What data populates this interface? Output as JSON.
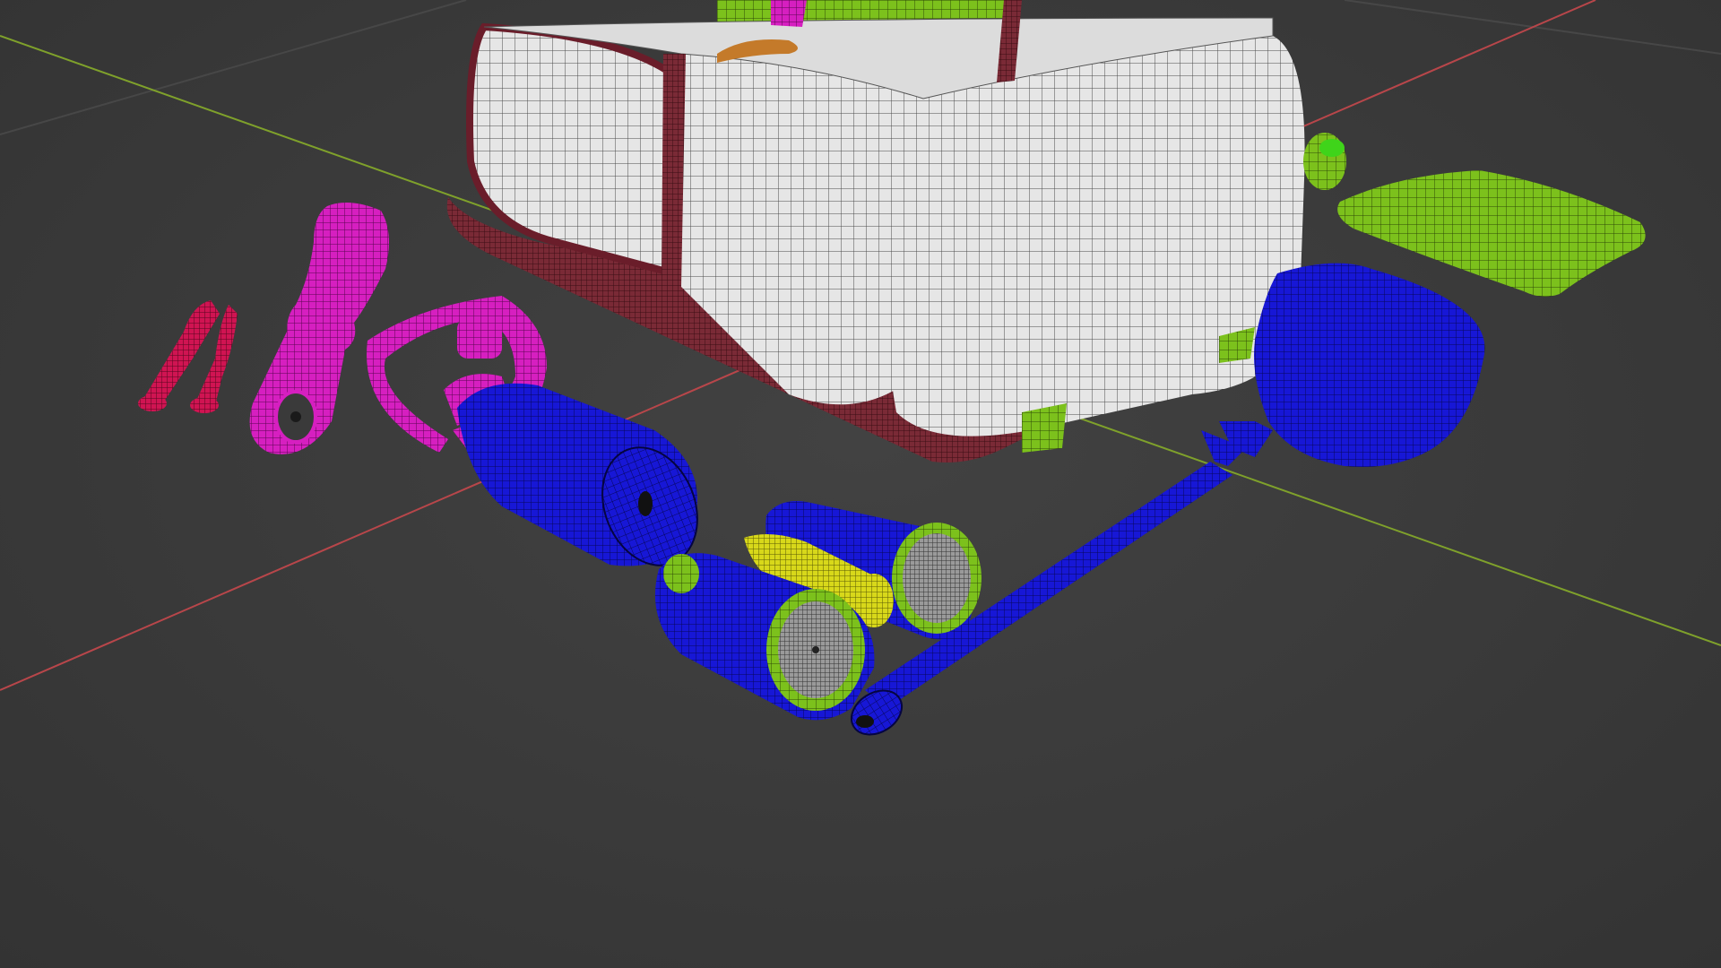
{
  "viewport": {
    "background": "#3b3b3b",
    "grid_axis_x_color": "#b8464a",
    "grid_axis_y_color": "#7fa12b",
    "grid_line_color": "#4a4a4a"
  },
  "objects": [
    {
      "name": "backpack",
      "color": "#e8e8e8",
      "accent": "#7a2a36"
    },
    {
      "name": "backpack-top-pocket",
      "color": "#7cc11c"
    },
    {
      "name": "pliers",
      "color": "#d01452"
    },
    {
      "name": "flashlight",
      "color": "#d61fc0"
    },
    {
      "name": "water-bottle",
      "color": "#1414d8",
      "accent": "#d61fc0"
    },
    {
      "name": "binoculars",
      "color": "#1414d8",
      "accent": "#6fbf1a",
      "lens": "#d8d81a"
    },
    {
      "name": "shovel",
      "color": "#1414d8"
    },
    {
      "name": "pouch",
      "color": "#7cc11c"
    },
    {
      "name": "canteen-cap",
      "color": "#3fd41a"
    }
  ]
}
